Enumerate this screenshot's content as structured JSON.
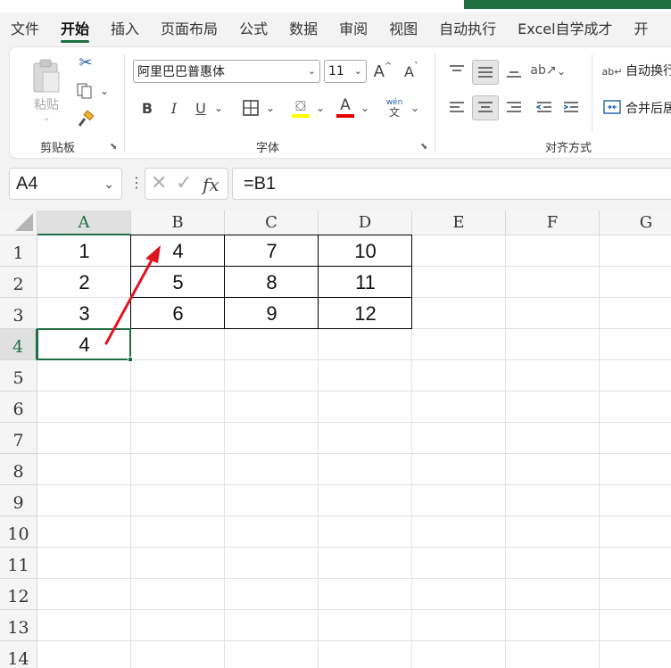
{
  "tabs": [
    "文件",
    "开始",
    "插入",
    "页面布局",
    "公式",
    "数据",
    "审阅",
    "视图",
    "自动执行",
    "Excel自学成才",
    "开"
  ],
  "active_tab": "开始",
  "ribbon": {
    "clipboard": {
      "paste_label": "粘贴",
      "group_label": "剪贴板"
    },
    "font": {
      "font_name": "阿里巴巴普惠体",
      "font_size": "11",
      "bold": "B",
      "italic": "I",
      "underline": "U",
      "grow": "A",
      "shrink": "A",
      "font_color_letter": "A",
      "phonetic_top": "wén",
      "phonetic_bottom": "文",
      "group_label": "字体",
      "highlight_color": "#ffff00",
      "font_color": "#e00000"
    },
    "alignment": {
      "wrap_text": "自动换行",
      "merge_center": "合并后居",
      "group_label": "对齐方式"
    }
  },
  "formula_bar": {
    "name_box": "A4",
    "formula": "=B1",
    "fx": "fx"
  },
  "columns": [
    "A",
    "B",
    "C",
    "D",
    "E",
    "F",
    "G"
  ],
  "selected_column": "A",
  "rows": [
    "1",
    "2",
    "3",
    "4",
    "5",
    "6",
    "7",
    "8",
    "9",
    "10",
    "11",
    "12",
    "13",
    "14"
  ],
  "selected_row": "4",
  "cells": [
    [
      "1",
      "4",
      "7",
      "10"
    ],
    [
      "2",
      "5",
      "8",
      "11"
    ],
    [
      "3",
      "6",
      "9",
      "12"
    ],
    [
      "4",
      "",
      "",
      ""
    ]
  ],
  "colors": {
    "accent": "#1e6e42",
    "arrow": "#e0141e"
  }
}
